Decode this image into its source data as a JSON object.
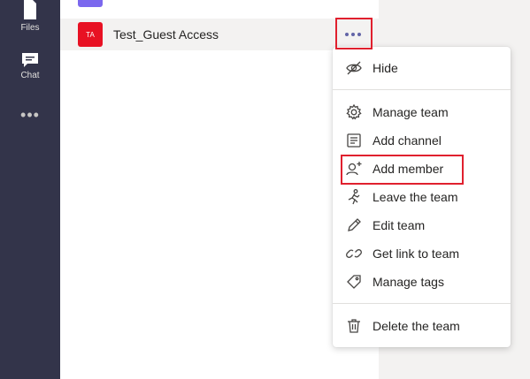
{
  "rail": {
    "items": [
      {
        "label": "Files",
        "icon": "file-icon"
      },
      {
        "label": "Chat",
        "icon": "chat-icon"
      }
    ],
    "more_label": "•••"
  },
  "team": {
    "avatar_initials": "TA",
    "avatar_color": "#e81123",
    "name": "Test_Guest Access"
  },
  "menu": {
    "items": [
      {
        "label": "Hide",
        "icon": "hide-icon"
      },
      {
        "label": "Manage team",
        "icon": "gear-icon"
      },
      {
        "label": "Add channel",
        "icon": "channel-icon"
      },
      {
        "label": "Add member",
        "icon": "add-person-icon"
      },
      {
        "label": "Leave the team",
        "icon": "leave-icon"
      },
      {
        "label": "Edit team",
        "icon": "pencil-icon"
      },
      {
        "label": "Get link to team",
        "icon": "link-icon"
      },
      {
        "label": "Manage tags",
        "icon": "tag-icon"
      },
      {
        "label": "Delete the team",
        "icon": "trash-icon"
      }
    ]
  },
  "colors": {
    "rail_bg": "#33344a",
    "accent": "#6264a7",
    "highlight": "#e0202e"
  }
}
